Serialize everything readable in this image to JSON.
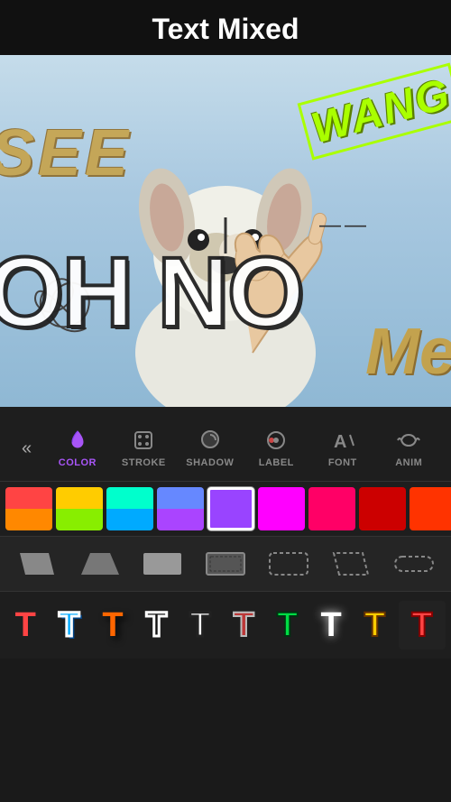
{
  "header": {
    "title": "Text Mixed"
  },
  "canvas": {
    "texts": {
      "see": "SEE",
      "wang": "WANG",
      "oh_no": "OH  NO",
      "me": "Me",
      "dash": "——"
    }
  },
  "toolbar": {
    "back_label": "«",
    "items": [
      {
        "id": "color",
        "label": "COLOR",
        "active": true,
        "icon": "droplet"
      },
      {
        "id": "stroke",
        "label": "STROKE",
        "active": false,
        "icon": "stroke"
      },
      {
        "id": "shadow",
        "label": "SHADOW",
        "active": false,
        "icon": "shadow"
      },
      {
        "id": "label",
        "label": "LABEL",
        "active": false,
        "icon": "label"
      },
      {
        "id": "font",
        "label": "FONT",
        "active": false,
        "icon": "font"
      },
      {
        "id": "anim",
        "label": "ANIM",
        "active": false,
        "icon": "anim"
      }
    ]
  },
  "colors": [
    {
      "id": 1,
      "value": "#ff4444",
      "selected": false
    },
    {
      "id": 2,
      "value": "#ff8800",
      "selected": false
    },
    {
      "id": 3,
      "value": "#ffee00",
      "selected": false
    },
    {
      "id": 4,
      "value": "#44ff44",
      "selected": false
    },
    {
      "id": 5,
      "value": "#00ffff",
      "selected": false
    },
    {
      "id": 6,
      "value": "#8888ff",
      "selected": false
    },
    {
      "id": 7,
      "value": "#9944ff",
      "selected": true
    },
    {
      "id": 8,
      "value": "#ff00ff",
      "selected": false
    },
    {
      "id": 9,
      "value": "#ff0066",
      "selected": false
    },
    {
      "id": 10,
      "value": "#ee0000",
      "selected": false
    }
  ],
  "shapes": [
    {
      "id": "parallelogram",
      "label": "parallelogram"
    },
    {
      "id": "trapezoid",
      "label": "trapezoid"
    },
    {
      "id": "rectangle",
      "label": "rectangle"
    },
    {
      "id": "dotted-rect",
      "label": "dotted-rectangle"
    },
    {
      "id": "rounded-dotted",
      "label": "rounded-dotted"
    },
    {
      "id": "parallelogram-outline",
      "label": "parallelogram-outline"
    },
    {
      "id": "pill",
      "label": "pill-outline"
    }
  ],
  "text_styles": [
    {
      "id": 1,
      "char": "T",
      "color": "#ff4444",
      "stroke": "none"
    },
    {
      "id": 2,
      "char": "T",
      "color": "#00aaff",
      "stroke": "#ffffff"
    },
    {
      "id": 3,
      "char": "T",
      "color": "#ff6600",
      "stroke": "none"
    },
    {
      "id": 4,
      "char": "T",
      "color": "#222222",
      "stroke": "#ffffff"
    },
    {
      "id": 5,
      "char": "T",
      "color": "#ffffff",
      "stroke": "#222"
    },
    {
      "id": 6,
      "char": "T",
      "color": "#ff4444",
      "stroke": "none"
    },
    {
      "id": 7,
      "char": "T",
      "color": "#00dd44",
      "stroke": "#222"
    },
    {
      "id": 8,
      "char": "T",
      "color": "#ffffff",
      "stroke": "none"
    },
    {
      "id": 9,
      "char": "T",
      "color": "#ffcc00",
      "stroke": "#222"
    },
    {
      "id": 10,
      "char": "T",
      "color": "#ff4444",
      "stroke": "#222"
    }
  ]
}
